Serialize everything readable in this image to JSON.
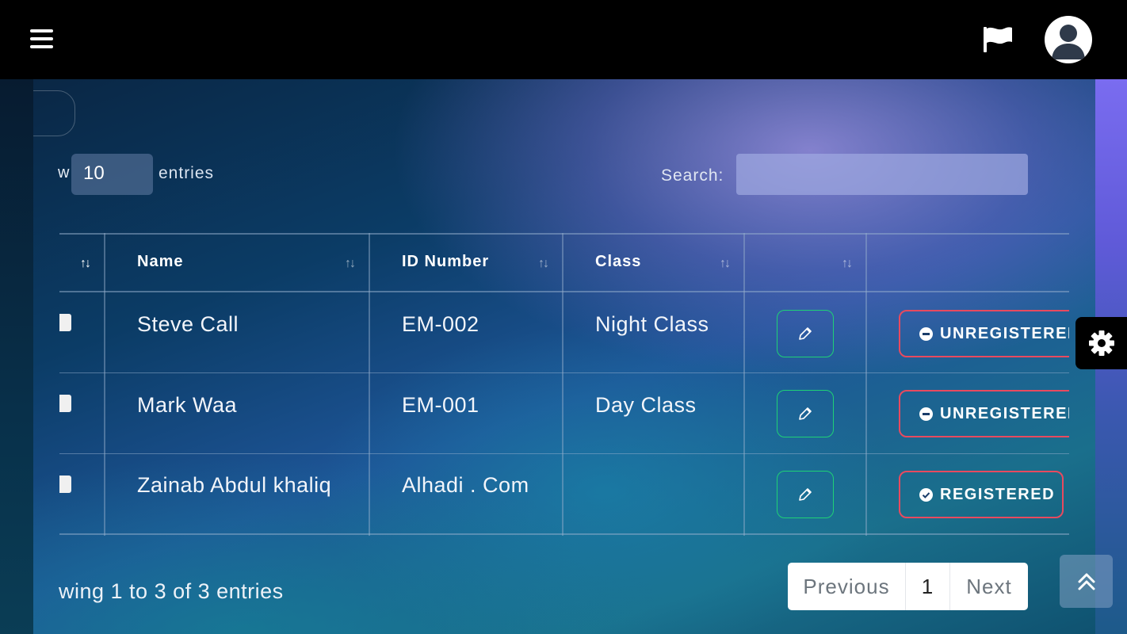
{
  "header": {
    "menu_icon": "hamburger-icon",
    "flag_icon": "flag-icon",
    "avatar_icon": "user-avatar-icon"
  },
  "length_control": {
    "show_label": "w",
    "value": "10",
    "suffix": "entries"
  },
  "search": {
    "label": "Search:",
    "value": ""
  },
  "table": {
    "columns": [
      {
        "label": ""
      },
      {
        "label": "Name"
      },
      {
        "label": "ID Number"
      },
      {
        "label": "Class"
      },
      {
        "label": ""
      },
      {
        "label": ""
      }
    ],
    "rows": [
      {
        "name": "Steve Call",
        "id_number": "EM-002",
        "class": "Night Class",
        "status": "UNREGISTERED",
        "status_icon": "minus-circle-icon"
      },
      {
        "name": "Mark Waa",
        "id_number": "EM-001",
        "class": "Day Class",
        "status": "UNREGISTERED",
        "status_icon": "minus-circle-icon"
      },
      {
        "name": "Zainab Abdul khaliq",
        "id_number": "Alhadi . Com",
        "class": "",
        "status": "REGISTERED",
        "status_icon": "check-circle-icon"
      }
    ]
  },
  "footer": {
    "info": "wing 1 to 3 of 3 entries"
  },
  "pagination": {
    "previous": "Previous",
    "current_page": "1",
    "next": "Next"
  },
  "colors": {
    "edit_border": "#1fd176",
    "status_border": "#e84a5f",
    "topbar": "#000000"
  }
}
